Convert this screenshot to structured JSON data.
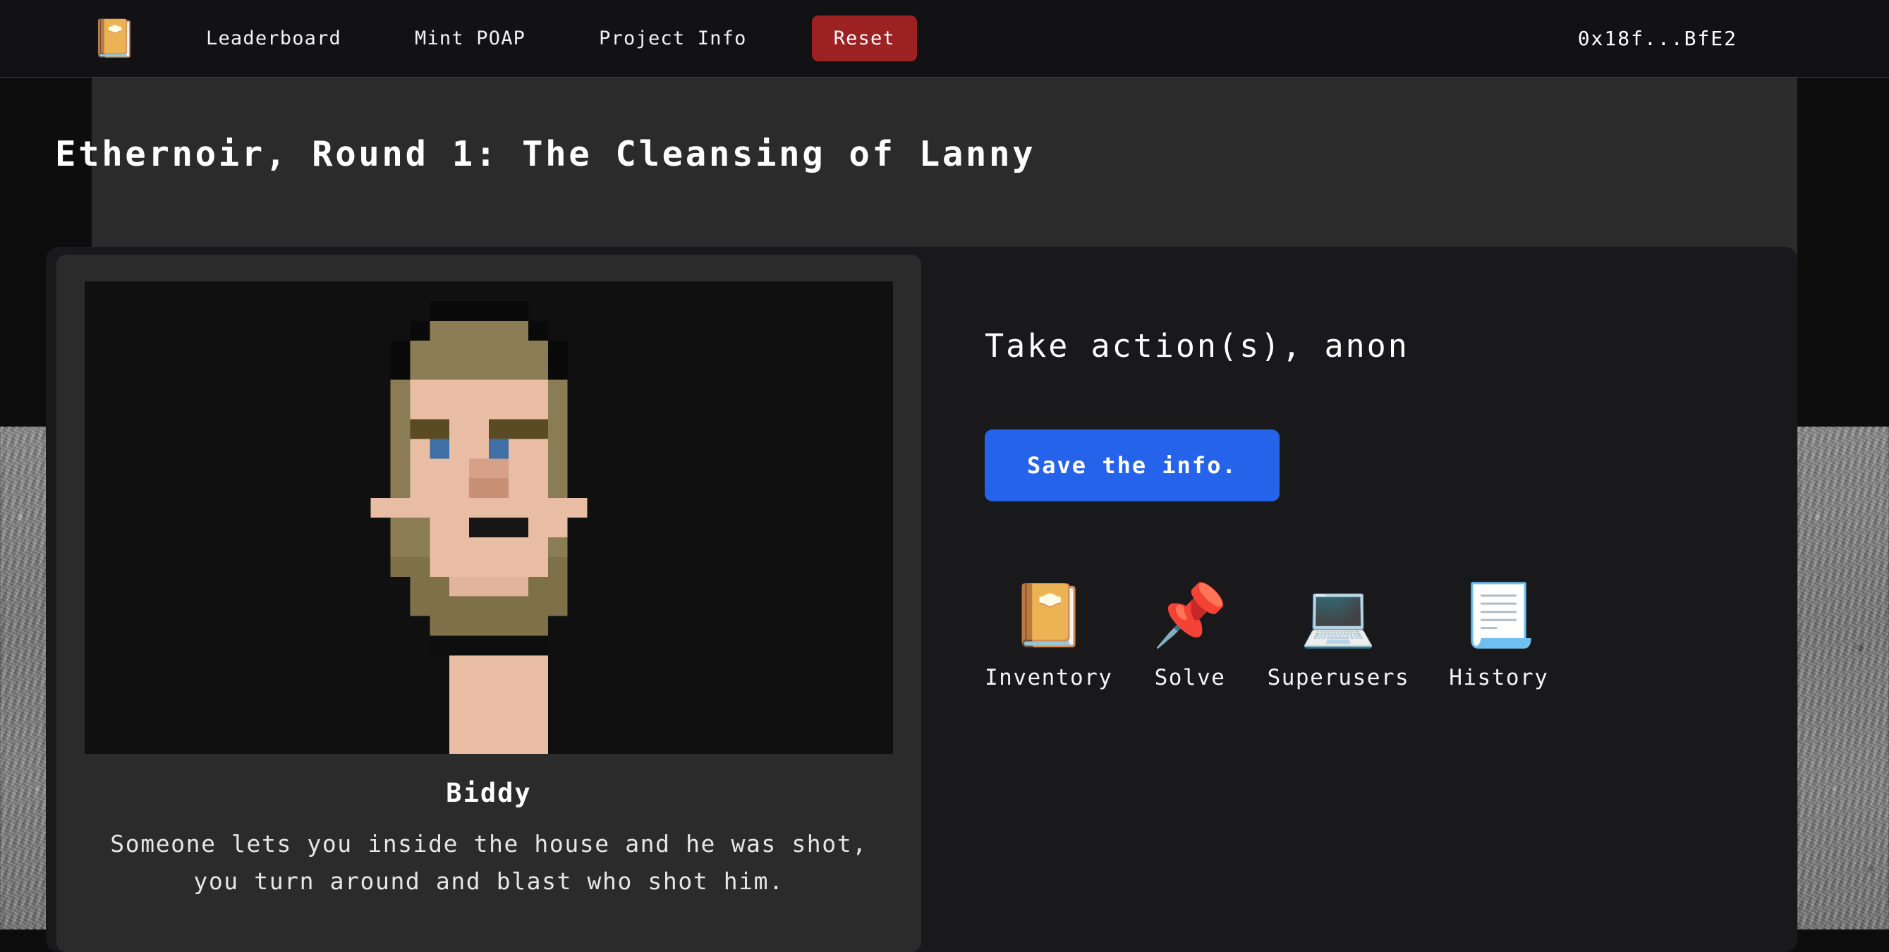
{
  "navbar": {
    "logo_icon": "notebook-icon",
    "logo_glyph": "📔",
    "links": [
      {
        "label": "Leaderboard"
      },
      {
        "label": "Mint POAP"
      },
      {
        "label": "Project Info"
      }
    ],
    "reset_label": "Reset",
    "reset_color": "#9e2122",
    "wallet_address": "0x18f...BfE2"
  },
  "page": {
    "title": "Ethernoir, Round 1: The Cleansing of Lanny"
  },
  "character": {
    "portrait_alt": "pixel-art portrait of a bearded man",
    "name": "Biddy",
    "quote": "Someone lets you inside the house and he was shot, you turn around and blast who shot him."
  },
  "actions": {
    "heading": "Take action(s), anon",
    "primary_label": "Save the info.",
    "primary_color": "#2563eb",
    "tools": [
      {
        "label": "Inventory",
        "icon": "notebook-icon",
        "glyph": "📔"
      },
      {
        "label": "Solve",
        "icon": "pushpin-icon",
        "glyph": "📌"
      },
      {
        "label": "Superusers",
        "icon": "laptop-icon",
        "glyph": "💻"
      },
      {
        "label": "History",
        "icon": "page-icon",
        "glyph": "📃"
      }
    ]
  },
  "theme": {
    "page_background": "#2b2b2b",
    "navbar_background": "#121214",
    "board_background": "#19191b",
    "card_background": "#2b2b2b",
    "portrait_background": "#101010",
    "text_color": "#ffffff"
  }
}
